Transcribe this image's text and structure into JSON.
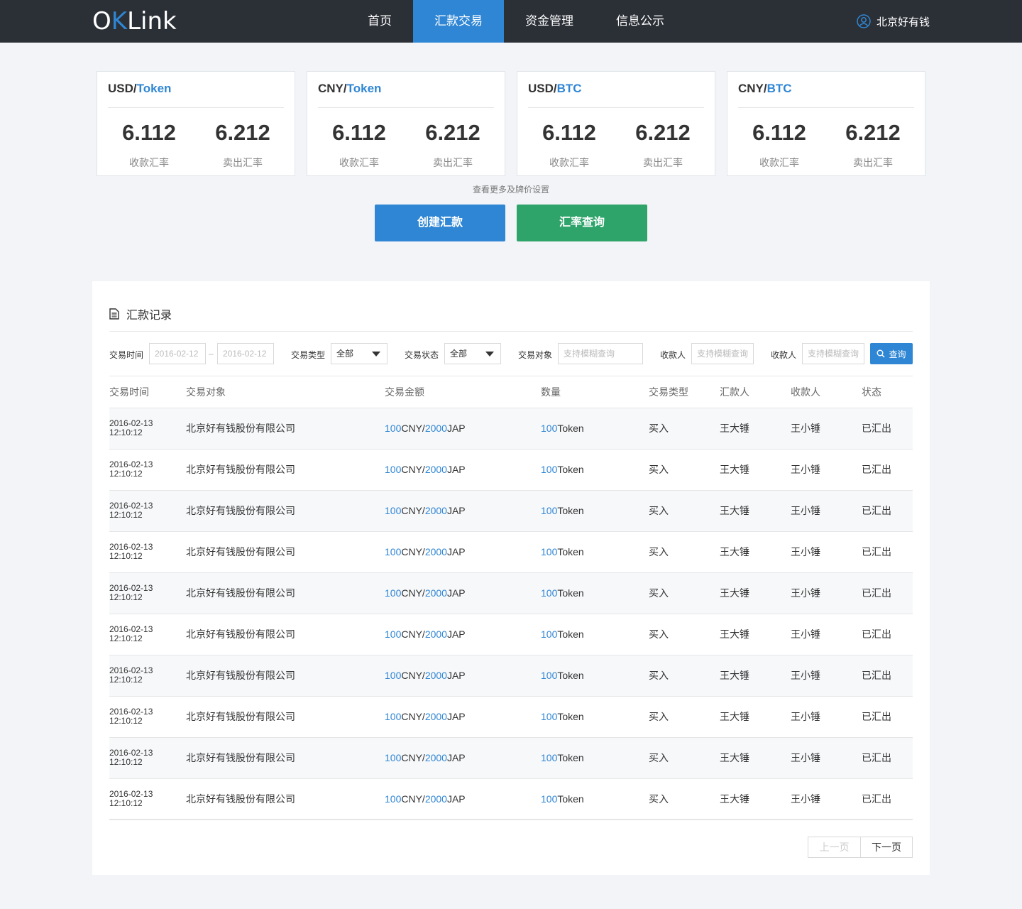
{
  "brand": {
    "logo_left": "O",
    "logo_k": "K",
    "logo_right": "Link"
  },
  "nav": {
    "items": [
      {
        "label": "首页",
        "active": false
      },
      {
        "label": "汇款交易",
        "active": true
      },
      {
        "label": "资金管理",
        "active": false
      },
      {
        "label": "信息公示",
        "active": false
      }
    ],
    "user": {
      "name": "北京好有钱",
      "icon": "user-icon"
    }
  },
  "rate_cards": [
    {
      "base": "USD/",
      "quote": "Token",
      "receive_rate": "6.112",
      "receive_label": "收款汇率",
      "sell_rate": "6.212",
      "sell_label": "卖出汇率"
    },
    {
      "base": "CNY/",
      "quote": "Token",
      "receive_rate": "6.112",
      "receive_label": "收款汇率",
      "sell_rate": "6.212",
      "sell_label": "卖出汇率"
    },
    {
      "base": "USD/",
      "quote": "BTC",
      "receive_rate": "6.112",
      "receive_label": "收款汇率",
      "sell_rate": "6.212",
      "sell_label": "卖出汇率"
    },
    {
      "base": "CNY/",
      "quote": "BTC",
      "receive_rate": "6.112",
      "receive_label": "收款汇率",
      "sell_rate": "6.212",
      "sell_label": "卖出汇率"
    }
  ],
  "more_link": "查看更多及牌价设置",
  "actions": {
    "create_label": "创建汇款",
    "query_label": "汇率查询"
  },
  "records": {
    "title": "汇款记录",
    "filters": {
      "time_label": "交易时间",
      "date_from": "2016-02-12",
      "date_sep": "–",
      "date_to": "2016-02-12",
      "type_label": "交易类型",
      "type_value": "全部",
      "status_label": "交易状态",
      "status_value": "全部",
      "target_label": "交易对象",
      "target_placeholder": "支持模糊查询",
      "payee1_label": "收款人",
      "payee1_placeholder": "支持模糊查询",
      "payee2_label": "收款人",
      "payee2_placeholder": "支持模糊查询",
      "search_label": "查询"
    },
    "columns": [
      "交易时间",
      "交易对象",
      "交易金额",
      "数量",
      "交易类型",
      "汇款人",
      "收款人",
      "状态"
    ],
    "rows": [
      {
        "date": "2016-02-13",
        "time": "12:10:12",
        "target": "北京好有钱股份有限公司",
        "amt1": "100",
        "cur1": "CNY/",
        "amt2": "2000",
        "cur2": "JAP",
        "qty": "100",
        "unit": "Token",
        "type": "买入",
        "sender": "王大锤",
        "payee": "王小锤",
        "status": "已汇出"
      },
      {
        "date": "2016-02-13",
        "time": "12:10:12",
        "target": "北京好有钱股份有限公司",
        "amt1": "100",
        "cur1": "CNY/",
        "amt2": "2000",
        "cur2": "JAP",
        "qty": "100",
        "unit": "Token",
        "type": "买入",
        "sender": "王大锤",
        "payee": "王小锤",
        "status": "已汇出"
      },
      {
        "date": "2016-02-13",
        "time": "12:10:12",
        "target": "北京好有钱股份有限公司",
        "amt1": "100",
        "cur1": "CNY/",
        "amt2": "2000",
        "cur2": "JAP",
        "qty": "100",
        "unit": "Token",
        "type": "买入",
        "sender": "王大锤",
        "payee": "王小锤",
        "status": "已汇出"
      },
      {
        "date": "2016-02-13",
        "time": "12:10:12",
        "target": "北京好有钱股份有限公司",
        "amt1": "100",
        "cur1": "CNY/",
        "amt2": "2000",
        "cur2": "JAP",
        "qty": "100",
        "unit": "Token",
        "type": "买入",
        "sender": "王大锤",
        "payee": "王小锤",
        "status": "已汇出"
      },
      {
        "date": "2016-02-13",
        "time": "12:10:12",
        "target": "北京好有钱股份有限公司",
        "amt1": "100",
        "cur1": "CNY/",
        "amt2": "2000",
        "cur2": "JAP",
        "qty": "100",
        "unit": "Token",
        "type": "买入",
        "sender": "王大锤",
        "payee": "王小锤",
        "status": "已汇出"
      },
      {
        "date": "2016-02-13",
        "time": "12:10:12",
        "target": "北京好有钱股份有限公司",
        "amt1": "100",
        "cur1": "CNY/",
        "amt2": "2000",
        "cur2": "JAP",
        "qty": "100",
        "unit": "Token",
        "type": "买入",
        "sender": "王大锤",
        "payee": "王小锤",
        "status": "已汇出"
      },
      {
        "date": "2016-02-13",
        "time": "12:10:12",
        "target": "北京好有钱股份有限公司",
        "amt1": "100",
        "cur1": "CNY/",
        "amt2": "2000",
        "cur2": "JAP",
        "qty": "100",
        "unit": "Token",
        "type": "买入",
        "sender": "王大锤",
        "payee": "王小锤",
        "status": "已汇出"
      },
      {
        "date": "2016-02-13",
        "time": "12:10:12",
        "target": "北京好有钱股份有限公司",
        "amt1": "100",
        "cur1": "CNY/",
        "amt2": "2000",
        "cur2": "JAP",
        "qty": "100",
        "unit": "Token",
        "type": "买入",
        "sender": "王大锤",
        "payee": "王小锤",
        "status": "已汇出"
      },
      {
        "date": "2016-02-13",
        "time": "12:10:12",
        "target": "北京好有钱股份有限公司",
        "amt1": "100",
        "cur1": "CNY/",
        "amt2": "2000",
        "cur2": "JAP",
        "qty": "100",
        "unit": "Token",
        "type": "买入",
        "sender": "王大锤",
        "payee": "王小锤",
        "status": "已汇出"
      },
      {
        "date": "2016-02-13",
        "time": "12:10:12",
        "target": "北京好有钱股份有限公司",
        "amt1": "100",
        "cur1": "CNY/",
        "amt2": "2000",
        "cur2": "JAP",
        "qty": "100",
        "unit": "Token",
        "type": "买入",
        "sender": "王大锤",
        "payee": "王小锤",
        "status": "已汇出"
      }
    ],
    "pager": {
      "prev_label": "上一页",
      "next_label": "下一页"
    }
  },
  "colors": {
    "accent": "#2f86d4",
    "green": "#2ea46a",
    "nav_bg": "#2b2f36",
    "page_bg": "#f2f4f7"
  }
}
